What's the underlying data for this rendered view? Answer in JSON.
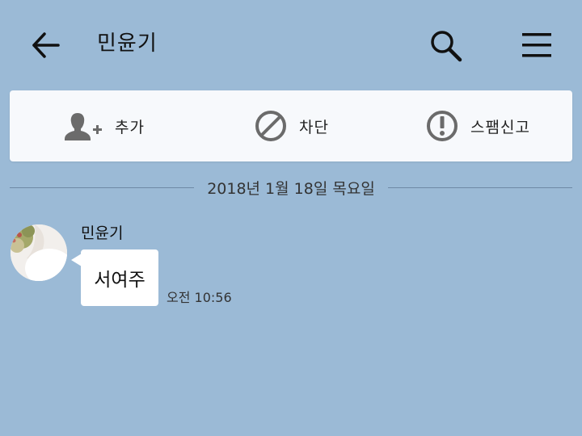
{
  "header": {
    "title": "민윤기",
    "back_icon": "arrow-left-icon",
    "search_icon": "search-icon",
    "menu_icon": "hamburger-menu-icon"
  },
  "actions": {
    "add": {
      "label": "추가",
      "icon": "add-friend-icon"
    },
    "block": {
      "label": "차단",
      "icon": "block-icon"
    },
    "spam": {
      "label": "스팸신고",
      "icon": "exclamation-circle-icon"
    }
  },
  "date_divider": "2018년 1월 18일 목요일",
  "message": {
    "sender": "민윤기",
    "text": "서여주",
    "time": "오전 10:56"
  },
  "colors": {
    "background": "#9bbad6",
    "action_bar": "#f7f9fc",
    "icon_gray": "#6b6b6b",
    "bubble": "#ffffff"
  }
}
